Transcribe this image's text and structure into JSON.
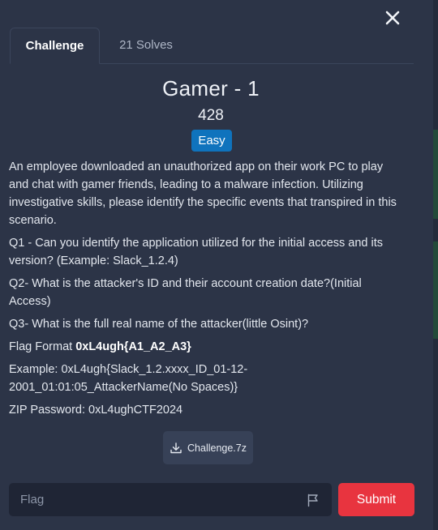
{
  "tabs": {
    "challenge": "Challenge",
    "solves": "21 Solves"
  },
  "challenge": {
    "title": "Gamer - 1",
    "points": "428",
    "difficulty": "Easy"
  },
  "description": {
    "intro": "An employee downloaded an unauthorized app on their work PC to play and chat with gamer friends, leading to a malware infection. Utilizing investigative skills, please identify the specific events that transpired in this scenario.",
    "q1": "Q1 - Can you identify the application utilized for the initial access and its version? (Example: Slack_1.2.4)",
    "q2": "Q2- What is the attacker's ID and their account creation date?(Initial Access)",
    "q3": "Q3- What is the full real name of the attacker(little Osint)?",
    "flag_format_label": "Flag Format ",
    "flag_format_value": "0xL4ugh{A1_A2_A3}",
    "example": "Example: 0xL4ugh{Slack_1.2.xxxx_ID_01-12-2001_01:01:05_AttackerName(No Spaces)}",
    "zip_password": "ZIP Password: 0xL4ughCTF2024"
  },
  "download": {
    "label": "Challenge.7z",
    "icon": "download-icon"
  },
  "flag_input": {
    "placeholder": "Flag",
    "value": "",
    "icon": "flag-icon"
  },
  "submit": {
    "label": "Submit"
  },
  "colors": {
    "background": "#2c3447",
    "difficulty_badge": "#0f73bd",
    "submit": "#e8343f",
    "input_bg": "#1f2535"
  }
}
